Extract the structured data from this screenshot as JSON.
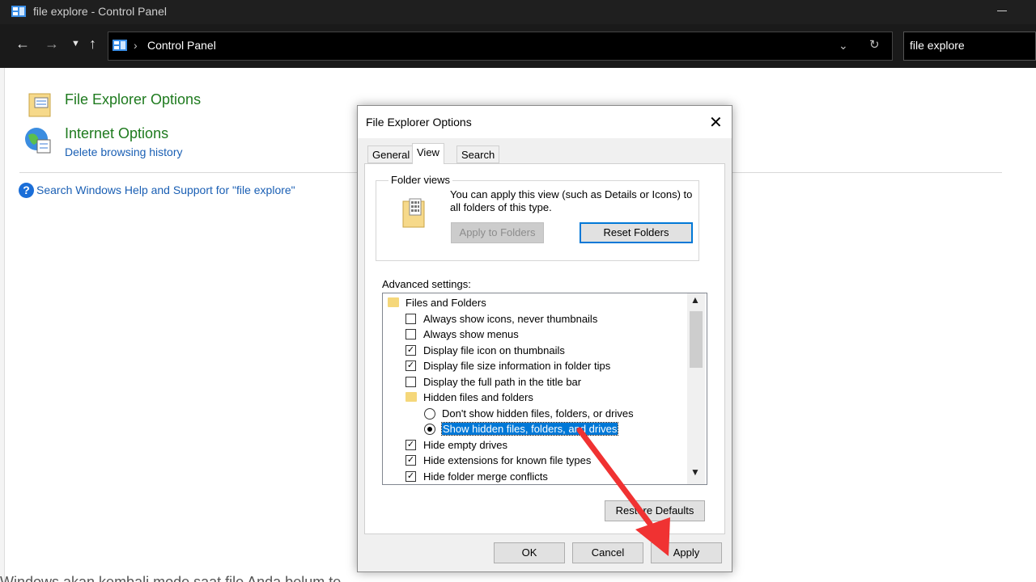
{
  "window": {
    "title": "file explore - Control Panel",
    "app_icon": "control-panel-icon"
  },
  "navigation": {
    "back_icon": "arrow-left-icon",
    "forward_icon": "arrow-right-icon",
    "recent_icon": "chevron-down-icon",
    "up_icon": "arrow-up-icon",
    "breadcrumb": "Control Panel",
    "breadcrumb_separator": "›",
    "search_value": "file explore"
  },
  "results": {
    "items": [
      {
        "title": "File Explorer Options",
        "subtitle": ""
      },
      {
        "title": "Internet Options",
        "subtitle": "Delete browsing history"
      }
    ],
    "help_link": "Search Windows Help and Support for \"file explore\""
  },
  "dialog": {
    "title": "File Explorer Options",
    "tabs": [
      "General",
      "View",
      "Search"
    ],
    "active_tab": "View",
    "folder_views": {
      "legend": "Folder views",
      "description": "You can apply this view (such as Details or Icons) to all folders of this type.",
      "apply_button": "Apply to Folders",
      "reset_button": "Reset Folders"
    },
    "advanced_label": "Advanced settings:",
    "advanced_items": [
      {
        "label": "Files and Folders",
        "kind": "folder",
        "checked": null
      },
      {
        "label": "Always show icons, never thumbnails",
        "kind": "checkbox",
        "checked": false
      },
      {
        "label": "Always show menus",
        "kind": "checkbox",
        "checked": false
      },
      {
        "label": "Display file icon on thumbnails",
        "kind": "checkbox",
        "checked": true
      },
      {
        "label": "Display file size information in folder tips",
        "kind": "checkbox",
        "checked": true
      },
      {
        "label": "Display the full path in the title bar",
        "kind": "checkbox",
        "checked": false
      },
      {
        "label": "Hidden files and folders",
        "kind": "folder",
        "checked": null
      },
      {
        "label": "Don't show hidden files, folders, or drives",
        "kind": "radio",
        "checked": false
      },
      {
        "label": "Show hidden files, folders, and drives",
        "kind": "radio",
        "checked": true
      },
      {
        "label": "Hide empty drives",
        "kind": "checkbox",
        "checked": true
      },
      {
        "label": "Hide extensions for known file types",
        "kind": "checkbox",
        "checked": true
      },
      {
        "label": "Hide folder merge conflicts",
        "kind": "checkbox",
        "checked": true
      }
    ],
    "restore_button": "Restore Defaults",
    "ok_button": "OK",
    "cancel_button": "Cancel",
    "apply_button": "Apply"
  },
  "background": {
    "partial_text": "Windows akan kembali mode saat file Anda belum te"
  },
  "colors": {
    "link_green": "#1e7a1e",
    "link_blue": "#1a5fb4",
    "selection": "#0078d7",
    "annotation_arrow": "#f03232"
  }
}
